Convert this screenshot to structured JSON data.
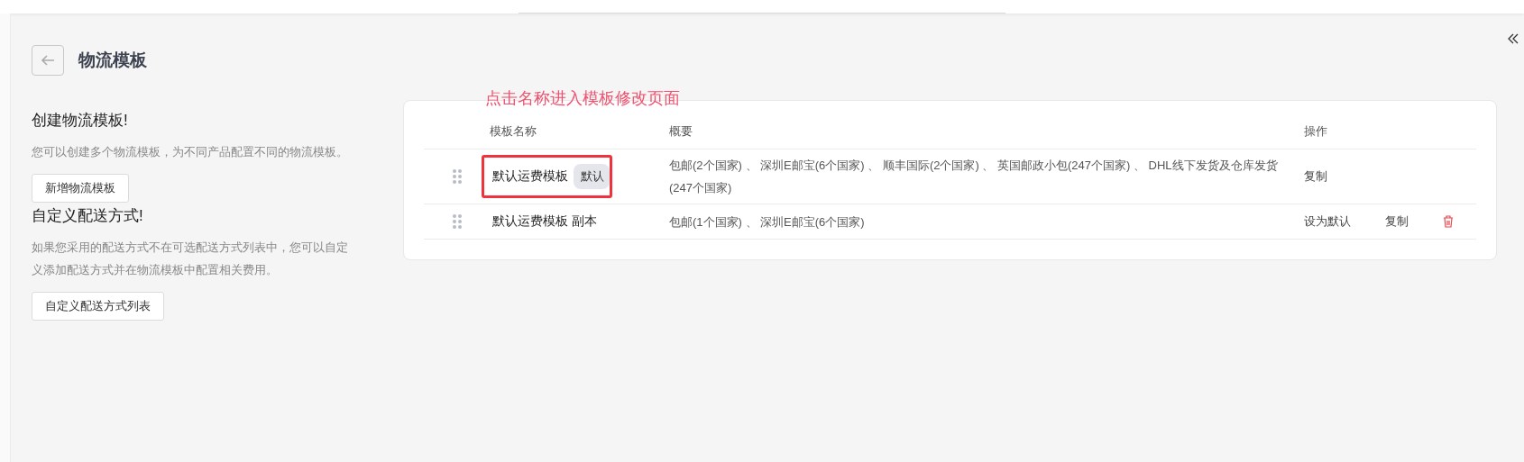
{
  "header": {
    "title": "物流模板"
  },
  "sections": [
    {
      "heading": "创建物流模板!",
      "description": "您可以创建多个物流模板，为不同产品配置不同的物流模板。",
      "button": "新增物流模板"
    },
    {
      "heading": "自定义配送方式!",
      "description": "如果您采用的配送方式不在可选配送方式列表中，您可以自定义添加配送方式并在物流模板中配置相关费用。",
      "button": "自定义配送方式列表"
    }
  ],
  "annotation": {
    "text": "点击名称进入模板修改页面"
  },
  "table": {
    "columns": [
      "模板名称",
      "概要",
      "操作"
    ],
    "rows": [
      {
        "name": "默认运费模板",
        "badge": "默认",
        "highlighted": true,
        "summary": "包邮(2个国家) 、 深圳E邮宝(6个国家) 、 顺丰国际(2个国家) 、 英国邮政小包(247个国家) 、 DHL线下发货及仓库发货(247个国家)",
        "actions": [
          "复制"
        ],
        "deletable": false
      },
      {
        "name": "默认运费模板 副本",
        "highlighted": false,
        "summary": "包邮(1个国家) 、 深圳E邮宝(6个国家)",
        "actions": [
          "设为默认",
          "复制"
        ],
        "deletable": true
      }
    ]
  }
}
